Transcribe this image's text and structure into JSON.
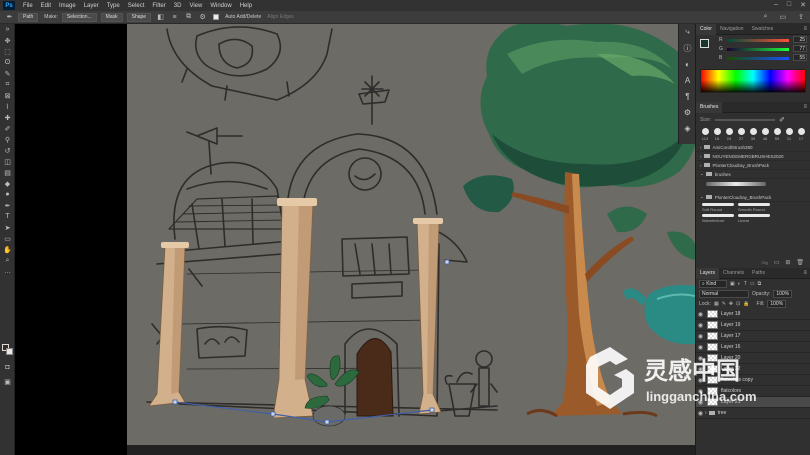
{
  "app": {
    "logo": "Ps",
    "menu": [
      "File",
      "Edit",
      "Image",
      "Layer",
      "Type",
      "Select",
      "Filter",
      "3D",
      "View",
      "Window",
      "Help"
    ]
  },
  "options_bar": {
    "mode": "Path",
    "make_label": "Make:",
    "selection_btn": "Selection...",
    "mask_btn": "Mask",
    "shape_btn": "Shape",
    "auto_add_delete": "Auto Add/Delete",
    "align_edges": "Align Edges"
  },
  "color_panel": {
    "tabs": [
      "Color",
      "Navigation",
      "Swatches"
    ],
    "sliders": [
      {
        "label": "R",
        "value": "25"
      },
      {
        "label": "G",
        "value": "77"
      },
      {
        "label": "B",
        "value": "55"
      }
    ]
  },
  "brushes_panel": {
    "tab": "Brushes",
    "size_label": "Size:",
    "presets": [
      {
        "size": "113"
      },
      {
        "size": "16"
      },
      {
        "size": "24"
      },
      {
        "size": "27"
      },
      {
        "size": "39"
      },
      {
        "size": "46"
      },
      {
        "size": "59"
      },
      {
        "size": "11"
      },
      {
        "size": "17"
      }
    ],
    "folders": [
      "AmiCorollStrush380",
      "NGUYENGEMERGBRUSHES2020",
      "PlonterCloudray_BrushPack",
      "brushes"
    ],
    "brush_subset_label": "PlonterCloudray_BrushPack",
    "strokes": [
      {
        "label": "Soft Round"
      },
      {
        "label": "Smooth Round"
      },
      {
        "label": "Wavetexture"
      },
      {
        "label": "Linear"
      }
    ],
    "footer": "Cfg"
  },
  "layers_panel": {
    "tabs": [
      "Layers",
      "Channels",
      "Paths"
    ],
    "kind_label": "Kind",
    "blend_mode": "Normal",
    "opacity_label": "Opacity:",
    "opacity_value": "100%",
    "lock_label": "Lock:",
    "fill_label": "Fill:",
    "fill_value": "100%",
    "layers": [
      {
        "name": "Layer 18",
        "selected": false
      },
      {
        "name": "Layer 19",
        "selected": false
      },
      {
        "name": "Layer 17",
        "selected": false
      },
      {
        "name": "Layer 16",
        "selected": false
      },
      {
        "name": "Layer 20",
        "selected": false
      },
      {
        "name": "Layer 22",
        "selected": false
      },
      {
        "name": "flatcolors copy",
        "selected": false
      },
      {
        "name": "flatcolors",
        "selected": false
      },
      {
        "name": "Layer 21",
        "selected": true
      },
      {
        "name": "tree",
        "selected": false
      }
    ]
  },
  "watermark": {
    "brand_cn": "灵感中国",
    "brand_url": "lingganchina.com"
  },
  "colors": {
    "canvas_bg": "#6d6b66",
    "tree_foliage": "#2f6a4a",
    "pillar": "#d2b08c",
    "door": "#4a2a18"
  }
}
